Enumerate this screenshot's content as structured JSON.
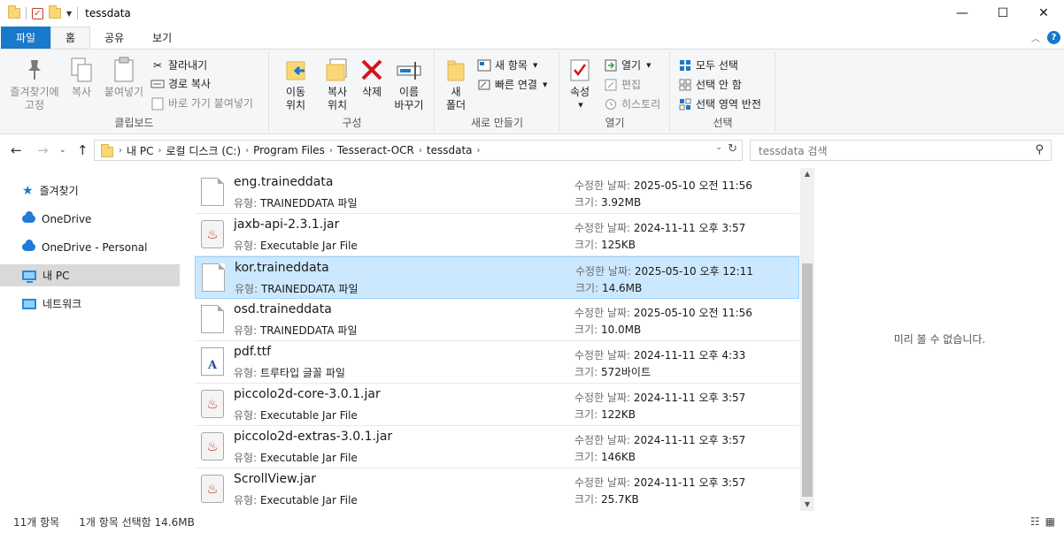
{
  "window": {
    "title": "tessdata"
  },
  "tabs": [
    {
      "label": "파일"
    },
    {
      "label": "홈"
    },
    {
      "label": "공유"
    },
    {
      "label": "보기"
    }
  ],
  "ribbon": {
    "clipboard": {
      "group_label": "클립보드",
      "pin_quick_access": "즐겨찾기에\n고정",
      "copy": "복사",
      "paste": "붙여넣기",
      "cut": "잘라내기",
      "copy_path": "경로 복사",
      "paste_shortcut": "바로 가기 붙여넣기"
    },
    "organize": {
      "group_label": "구성",
      "move_to": "이동\n위치",
      "copy_to": "복사\n위치",
      "delete": "삭제",
      "rename": "이름\n바꾸기"
    },
    "new": {
      "group_label": "새로 만들기",
      "new_folder": "새\n폴더",
      "new_item": "새 항목",
      "easy_access": "빠른 연결"
    },
    "open": {
      "group_label": "열기",
      "properties": "속성",
      "open": "열기",
      "edit": "편집",
      "history": "히스토리"
    },
    "select": {
      "group_label": "선택",
      "select_all": "모두 선택",
      "select_none": "선택 안 함",
      "invert": "선택 영역 반전"
    }
  },
  "address": {
    "crumbs": [
      "내 PC",
      "로컬 디스크 (C:)",
      "Program Files",
      "Tesseract-OCR",
      "tessdata"
    ],
    "search_placeholder": "tessdata 검색"
  },
  "nav": [
    {
      "label": "즐겨찾기",
      "icon": "star-icon"
    },
    {
      "label": "OneDrive",
      "icon": "cloud-icon"
    },
    {
      "label": "OneDrive - Personal",
      "icon": "cloud-icon"
    },
    {
      "label": "내 PC",
      "icon": "computer-icon"
    },
    {
      "label": "네트워크",
      "icon": "network-icon"
    }
  ],
  "labels": {
    "type": "유형:",
    "modified": "수정한 날짜:",
    "size": "크기:"
  },
  "files": [
    {
      "name": "eng.traineddata",
      "type": "TRAINEDDATA 파일",
      "modified": "2025-05-10 오전 11:56",
      "size": "3.92MB",
      "icon": "document-icon"
    },
    {
      "name": "jaxb-api-2.3.1.jar",
      "type": "Executable Jar File",
      "modified": "2024-11-11 오후 3:57",
      "size": "125KB",
      "icon": "java-jar-icon"
    },
    {
      "name": "kor.traineddata",
      "type": "TRAINEDDATA 파일",
      "modified": "2025-05-10 오후 12:11",
      "size": "14.6MB",
      "icon": "document-icon",
      "selected": true
    },
    {
      "name": "osd.traineddata",
      "type": "TRAINEDDATA 파일",
      "modified": "2025-05-10 오전 11:56",
      "size": "10.0MB",
      "icon": "document-icon"
    },
    {
      "name": "pdf.ttf",
      "type": "트루타입 글꼴 파일",
      "modified": "2024-11-11 오후 4:33",
      "size": "572바이트",
      "icon": "font-file-icon"
    },
    {
      "name": "piccolo2d-core-3.0.1.jar",
      "type": "Executable Jar File",
      "modified": "2024-11-11 오후 3:57",
      "size": "122KB",
      "icon": "java-jar-icon"
    },
    {
      "name": "piccolo2d-extras-3.0.1.jar",
      "type": "Executable Jar File",
      "modified": "2024-11-11 오후 3:57",
      "size": "146KB",
      "icon": "java-jar-icon"
    },
    {
      "name": "ScrollView.jar",
      "type": "Executable Jar File",
      "modified": "2024-11-11 오후 3:57",
      "size": "25.7KB",
      "icon": "java-jar-icon"
    }
  ],
  "preview": {
    "message": "미리 볼 수 없습니다."
  },
  "status": {
    "item_count": "11개 항목",
    "selection": "1개 항목 선택함 14.6MB"
  },
  "colors": {
    "accent": "#1979ca",
    "selection": "#cce8ff",
    "selection_border": "#99d1ff"
  }
}
